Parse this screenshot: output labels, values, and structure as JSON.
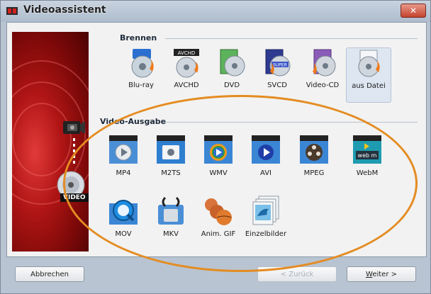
{
  "window": {
    "title": "Videoassistent",
    "close_label": "✕"
  },
  "sidebar": {
    "disc_label": "VIDEO"
  },
  "burn": {
    "heading": "Brennen",
    "items": [
      {
        "label": "Blu-ray",
        "icon": "bluray-disc-icon"
      },
      {
        "label": "AVCHD",
        "icon": "avchd-disc-icon",
        "badge": "AVCHD"
      },
      {
        "label": "DVD",
        "icon": "dvd-disc-icon"
      },
      {
        "label": "SVCD",
        "icon": "svcd-disc-icon",
        "badge": "SUPER"
      },
      {
        "label": "Video-CD",
        "icon": "video-cd-disc-icon"
      },
      {
        "label": "aus Datei",
        "icon": "disc-from-file-icon"
      }
    ]
  },
  "output": {
    "heading": "Video-Ausgabe",
    "items": [
      {
        "label": "MP4",
        "icon": "mp4-clapper-icon"
      },
      {
        "label": "M2TS",
        "icon": "m2ts-clapper-icon"
      },
      {
        "label": "WMV",
        "icon": "wmv-clapper-icon"
      },
      {
        "label": "AVI",
        "icon": "avi-clapper-icon"
      },
      {
        "label": "MPEG",
        "icon": "mpeg-film-reel-icon"
      },
      {
        "label": "WebM",
        "icon": "webm-clapper-icon",
        "badge": "web m"
      },
      {
        "label": "MOV",
        "icon": "quicktime-icon"
      },
      {
        "label": "MKV",
        "icon": "mkv-icon"
      },
      {
        "label": "Anim. GIF",
        "icon": "animated-gif-icon"
      },
      {
        "label": "Einzelbilder",
        "icon": "single-images-icon"
      }
    ]
  },
  "footer": {
    "cancel": "Abbrechen",
    "back": "< Zurück",
    "next_prefix": "W",
    "next_rest": "eiter >"
  },
  "colors": {
    "accent_ellipse": "#e48c22",
    "sidebar_red": "#b01515"
  }
}
